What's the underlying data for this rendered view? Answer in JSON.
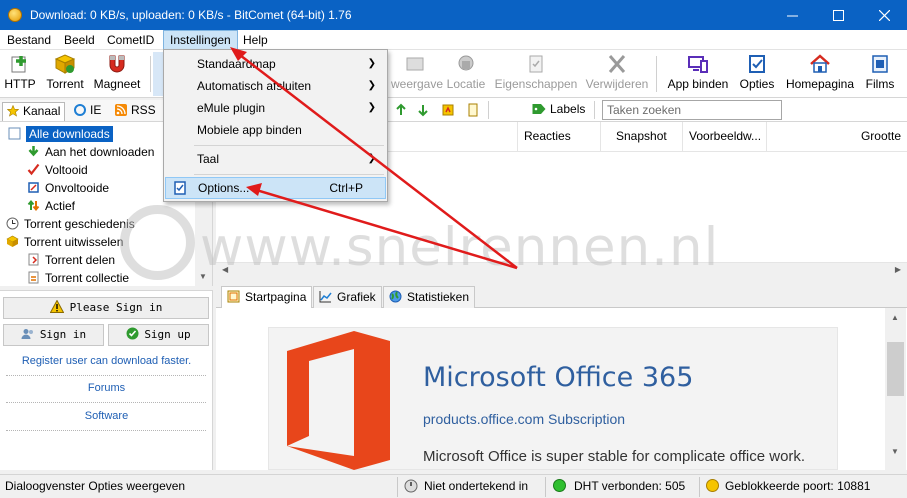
{
  "window": {
    "title": "Download: 0 KB/s, uploaden: 0 KB/s - BitComet (64-bit) 1.76",
    "minimize_icon": "minimize-icon",
    "maximize_icon": "maximize-icon",
    "close_icon": "close-icon"
  },
  "menubar": {
    "items": [
      "Bestand",
      "Beeld",
      "CometID",
      "Instellingen",
      "Help"
    ]
  },
  "toolbar": {
    "http": "HTTP",
    "torrent": "Torrent",
    "magnet": "Magneet",
    "preview": "weergave",
    "location": "Locatie",
    "properties": "Eigenschappen",
    "remove": "Verwijderen",
    "bind_app": "App binden",
    "options": "Opties",
    "homepage": "Homepagina",
    "films": "Films"
  },
  "left_tabs": [
    "Kanaal",
    "IE",
    "RSS"
  ],
  "tree": {
    "items": [
      "Alle downloads",
      "Aan het downloaden",
      "Voltooid",
      "Onvoltooide",
      "Actief",
      "Torrent geschiedenis",
      "Torrent uitwisselen",
      "Torrent delen",
      "Torrent collectie"
    ]
  },
  "sign_panel": {
    "please_sign_in": "Please Sign in",
    "sign_in": "Sign in",
    "sign_up": "Sign up",
    "promo": "Register user can download faster.",
    "forums": "Forums",
    "software": "Software"
  },
  "subtoolbar": {
    "labels": "Labels",
    "search_placeholder": "Taken zoeken"
  },
  "list_columns": [
    "Reacties",
    "Snapshot",
    "Voorbeeldw...",
    "Grootte"
  ],
  "bottom_tabs": [
    "Startpagina",
    "Grafiek",
    "Statistieken"
  ],
  "ad": {
    "title": "Microsoft Office 365",
    "subtitle": "products.office.com Subscription",
    "body": "Microsoft Office is super stable for complicate office work."
  },
  "statusbar": {
    "message": "Dialoogvenster Opties weergeven",
    "signin_status": "Niet ondertekend in",
    "dht": "DHT verbonden: 505",
    "blocked_port": "Geblokkeerde poort: 10881"
  },
  "dropdown": {
    "items": [
      {
        "label": "Standaardmap",
        "submenu": true
      },
      {
        "label": "Automatisch afsluiten",
        "submenu": true
      },
      {
        "label": "eMule plugin",
        "submenu": true
      },
      {
        "label": "Mobiele app binden",
        "submenu": false
      },
      {
        "label": "Taal",
        "submenu": true
      },
      {
        "label": "Options...",
        "shortcut": "Ctrl+P",
        "highlighted": true
      }
    ]
  },
  "watermark": {
    "text": "www.snelrennen.nl"
  },
  "colors": {
    "titlebar": "#0a62c4",
    "selection": "#0a62c4",
    "menu_highlight": "#cce4f7",
    "arrow": "#e01b1b",
    "office_orange": "#e8461b",
    "link": "#2f5f9f"
  }
}
